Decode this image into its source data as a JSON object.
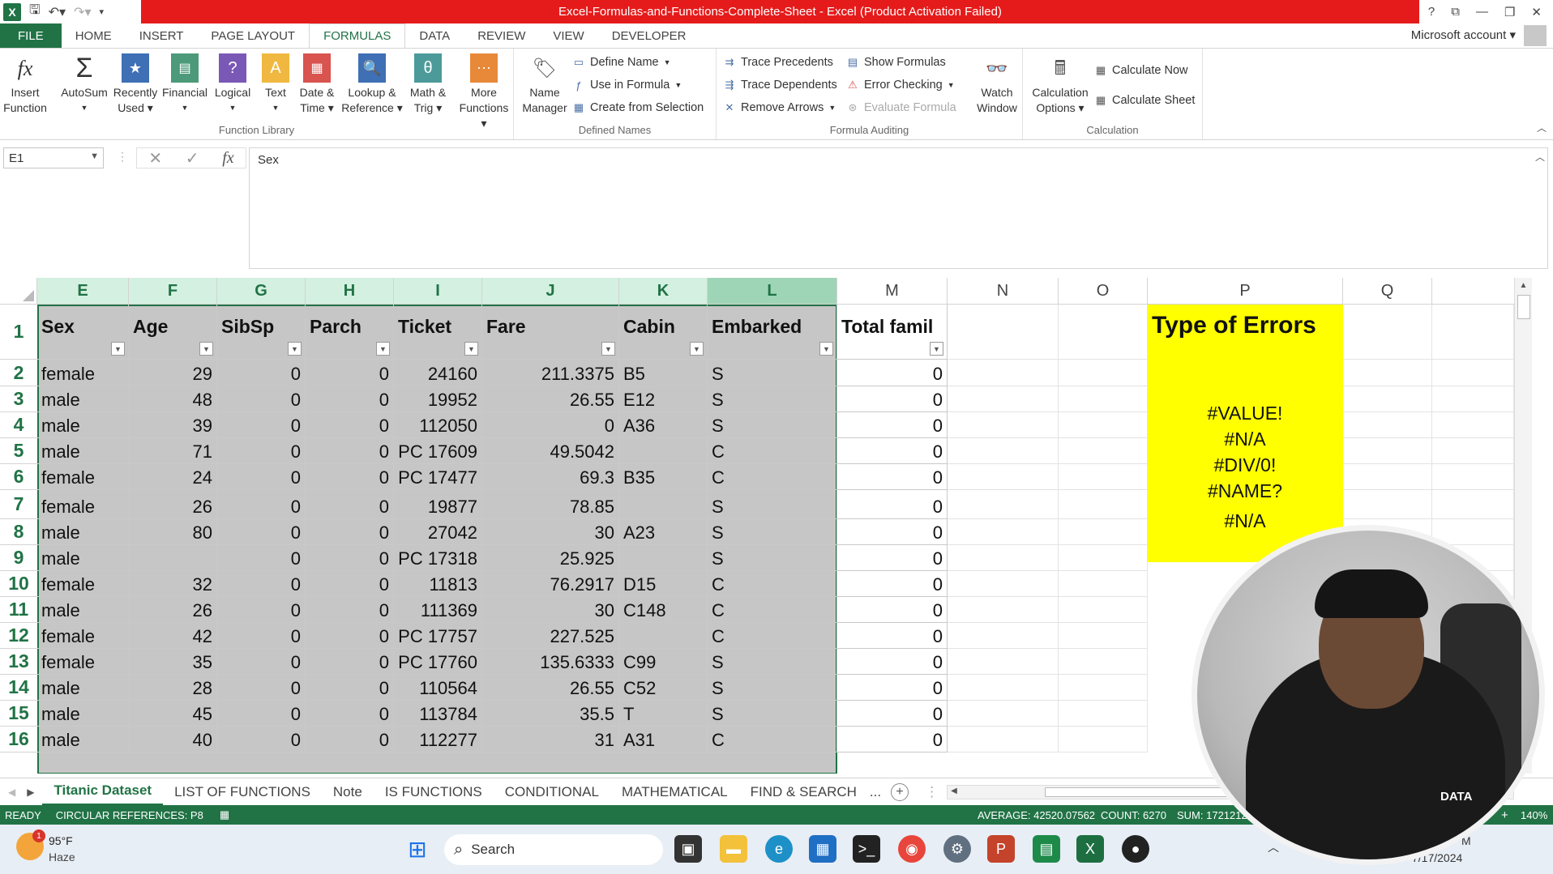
{
  "title": {
    "app_title": "Excel-Formulas-and-Functions-Complete-Sheet -  Excel (Product Activation Failed)",
    "help": "?"
  },
  "tabs": [
    {
      "label": "FILE"
    },
    {
      "label": "HOME"
    },
    {
      "label": "INSERT"
    },
    {
      "label": "PAGE LAYOUT"
    },
    {
      "label": "FORMULAS"
    },
    {
      "label": "DATA"
    },
    {
      "label": "REVIEW"
    },
    {
      "label": "VIEW"
    },
    {
      "label": "DEVELOPER"
    }
  ],
  "account": "Microsoft account",
  "ribbon": {
    "function_library": {
      "label": "Function Library",
      "insert_function": [
        "Insert",
        "Function"
      ],
      "autosum": "AutoSum",
      "recently_used": [
        "Recently",
        "Used"
      ],
      "financial": "Financial",
      "logical": "Logical",
      "text": "Text",
      "date_time": [
        "Date &",
        "Time"
      ],
      "lookup_reference": [
        "Lookup &",
        "Reference"
      ],
      "math_trig": [
        "Math &",
        "Trig"
      ],
      "more_functions": [
        "More",
        "Functions"
      ]
    },
    "defined_names": {
      "label": "Defined Names",
      "name_manager": [
        "Name",
        "Manager"
      ],
      "define_name": "Define Name",
      "use_in_formula": "Use in Formula",
      "create_from_selection": "Create from Selection"
    },
    "formula_auditing": {
      "label": "Formula Auditing",
      "trace_precedents": "Trace Precedents",
      "trace_dependents": "Trace Dependents",
      "remove_arrows": "Remove Arrows",
      "show_formulas": "Show Formulas",
      "error_checking": "Error Checking",
      "evaluate_formula": "Evaluate Formula",
      "watch_window": [
        "Watch",
        "Window"
      ]
    },
    "calculation": {
      "label": "Calculation",
      "calculation_options": [
        "Calculation",
        "Options"
      ],
      "calculate_now": "Calculate Now",
      "calculate_sheet": "Calculate Sheet"
    }
  },
  "formula_bar": {
    "name_box": "E1",
    "content": "Sex",
    "fx": "fx"
  },
  "columns": [
    "E",
    "F",
    "G",
    "H",
    "I",
    "J",
    "K",
    "L",
    "M",
    "N",
    "O",
    "P",
    "Q"
  ],
  "headers": [
    "Sex",
    "Age",
    "SibSp",
    "Parch",
    "Ticket",
    "Fare",
    "Cabin",
    "Embarked",
    "Total famil"
  ],
  "rows": [
    {
      "n": "1"
    },
    {
      "n": "2",
      "sex": "female",
      "age": "29",
      "sibsp": "0",
      "parch": "0",
      "ticket": "24160",
      "fare": "211.3375",
      "cabin": "B5",
      "emb": "S",
      "tot": "0"
    },
    {
      "n": "3",
      "sex": "male",
      "age": "48",
      "sibsp": "0",
      "parch": "0",
      "ticket": "19952",
      "fare": "26.55",
      "cabin": "E12",
      "emb": "S",
      "tot": "0"
    },
    {
      "n": "4",
      "sex": "male",
      "age": "39",
      "sibsp": "0",
      "parch": "0",
      "ticket": "112050",
      "fare": "0",
      "cabin": "A36",
      "emb": "S",
      "tot": "0"
    },
    {
      "n": "5",
      "sex": "male",
      "age": "71",
      "sibsp": "0",
      "parch": "0",
      "ticket": "PC 17609",
      "fare": "49.5042",
      "cabin": "",
      "emb": "C",
      "tot": "0"
    },
    {
      "n": "6",
      "sex": "female",
      "age": "24",
      "sibsp": "0",
      "parch": "0",
      "ticket": "PC 17477",
      "fare": "69.3",
      "cabin": "B35",
      "emb": "C",
      "tot": "0"
    },
    {
      "n": "7",
      "sex": "female",
      "age": "26",
      "sibsp": "0",
      "parch": "0",
      "ticket": "19877",
      "fare": "78.85",
      "cabin": "",
      "emb": "S",
      "tot": "0"
    },
    {
      "n": "8",
      "sex": "male",
      "age": "80",
      "sibsp": "0",
      "parch": "0",
      "ticket": "27042",
      "fare": "30",
      "cabin": "A23",
      "emb": "S",
      "tot": "0"
    },
    {
      "n": "9",
      "sex": "male",
      "age": "",
      "sibsp": "0",
      "parch": "0",
      "ticket": "PC 17318",
      "fare": "25.925",
      "cabin": "",
      "emb": "S",
      "tot": "0"
    },
    {
      "n": "10",
      "sex": "female",
      "age": "32",
      "sibsp": "0",
      "parch": "0",
      "ticket": "11813",
      "fare": "76.2917",
      "cabin": "D15",
      "emb": "C",
      "tot": "0"
    },
    {
      "n": "11",
      "sex": "male",
      "age": "26",
      "sibsp": "0",
      "parch": "0",
      "ticket": "111369",
      "fare": "30",
      "cabin": "C148",
      "emb": "C",
      "tot": "0"
    },
    {
      "n": "12",
      "sex": "female",
      "age": "42",
      "sibsp": "0",
      "parch": "0",
      "ticket": "PC 17757",
      "fare": "227.525",
      "cabin": "",
      "emb": "C",
      "tot": "0"
    },
    {
      "n": "13",
      "sex": "female",
      "age": "35",
      "sibsp": "0",
      "parch": "0",
      "ticket": "PC 17760",
      "fare": "135.6333",
      "cabin": "C99",
      "emb": "S",
      "tot": "0"
    },
    {
      "n": "14",
      "sex": "male",
      "age": "28",
      "sibsp": "0",
      "parch": "0",
      "ticket": "110564",
      "fare": "26.55",
      "cabin": "C52",
      "emb": "S",
      "tot": "0"
    },
    {
      "n": "15",
      "sex": "male",
      "age": "45",
      "sibsp": "0",
      "parch": "0",
      "ticket": "113784",
      "fare": "35.5",
      "cabin": "T",
      "emb": "S",
      "tot": "0"
    },
    {
      "n": "16",
      "sex": "male",
      "age": "40",
      "sibsp": "0",
      "parch": "0",
      "ticket": "112277",
      "fare": "31",
      "cabin": "A31",
      "emb": "C",
      "tot": "0"
    }
  ],
  "errors_box": {
    "title": "Type of Errors",
    "items": [
      "#VALUE!",
      "#N/A",
      "#DIV/0!",
      "#NAME?",
      "#N/A"
    ]
  },
  "sheet_tabs": [
    "Titanic Dataset",
    "LIST OF FUNCTIONS",
    "Note",
    "IS FUNCTIONS",
    "CONDITIONAL",
    "MATHEMATICAL",
    "FIND & SEARCH",
    "..."
  ],
  "status": {
    "ready": "READY",
    "circular": "CIRCULAR REFERENCES: P8",
    "average": "AVERAGE: 42520.07562",
    "count": "COUNT: 6270",
    "sum": "SUM: 1721212",
    "zoom": "140%"
  },
  "taskbar": {
    "temp": "95°F",
    "weather": "Haze",
    "search": "Search",
    "date": "7/17/2024",
    "time": "M"
  },
  "webcam_watermark": "DATA"
}
